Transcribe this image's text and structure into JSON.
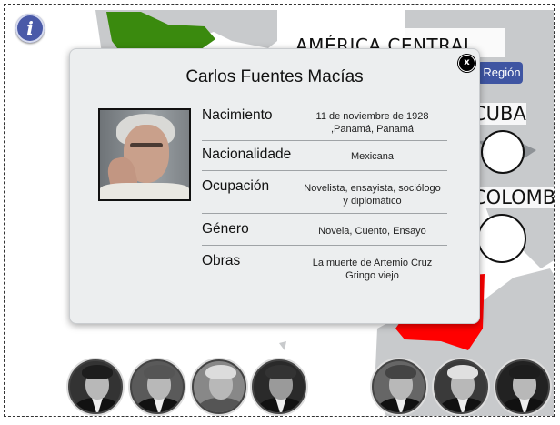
{
  "info_button": {
    "label": "i"
  },
  "region": {
    "title": "AMÉRICA CENTRAL",
    "button_label": "Región"
  },
  "countries": [
    {
      "label": "CUBA"
    },
    {
      "label": "COLOMBIA"
    }
  ],
  "map_colors": {
    "green": "#3a8a0e",
    "red": "#ff0000",
    "land": "#c8cacc",
    "sea": "#ffffff"
  },
  "modal": {
    "close_label": "x",
    "title": "Carlos Fuentes Macías",
    "rows": [
      {
        "label": "Nacimiento",
        "value": "11 de noviembre de 1928\n,Panamá, Panamá"
      },
      {
        "label": "Nacionalidade",
        "value": "Mexicana"
      },
      {
        "label": "Ocupación",
        "value": "Novelista, ensayista, sociólogo\ny diplomático"
      },
      {
        "label": "Género",
        "value": "Novela, Cuento, Ensayo"
      },
      {
        "label": "Obras",
        "value": "La muerte de Artemio Cruz\nGringo viejo"
      }
    ]
  }
}
